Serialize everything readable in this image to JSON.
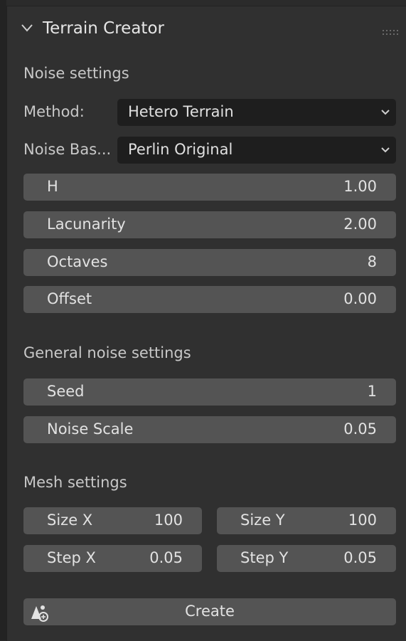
{
  "panel": {
    "title": "Terrain Creator"
  },
  "noise_settings": {
    "heading": "Noise settings",
    "method": {
      "label": "Method:",
      "value": "Hetero Terrain"
    },
    "noise_basis": {
      "label": "Noise Bas...",
      "value": "Perlin Original"
    },
    "fields": [
      {
        "label": "H",
        "value": "1.00"
      },
      {
        "label": "Lacunarity",
        "value": "2.00"
      },
      {
        "label": "Octaves",
        "value": "8"
      },
      {
        "label": "Offset",
        "value": "0.00"
      }
    ]
  },
  "general_noise_settings": {
    "heading": "General noise settings",
    "fields": [
      {
        "label": "Seed",
        "value": "1"
      },
      {
        "label": "Noise Scale",
        "value": "0.05"
      }
    ]
  },
  "mesh_settings": {
    "heading": "Mesh settings",
    "size_x": {
      "label": "Size X",
      "value": "100"
    },
    "size_y": {
      "label": "Size Y",
      "value": "100"
    },
    "step_x": {
      "label": "Step X",
      "value": "0.05"
    },
    "step_y": {
      "label": "Step Y",
      "value": "0.05"
    }
  },
  "create_button": {
    "label": "Create",
    "icon": "add-object-icon"
  },
  "colors": {
    "panel_bg": "#303030",
    "field_bg": "#545454",
    "dropdown_bg": "#1e1e1e",
    "text": "#e2e2e2"
  }
}
